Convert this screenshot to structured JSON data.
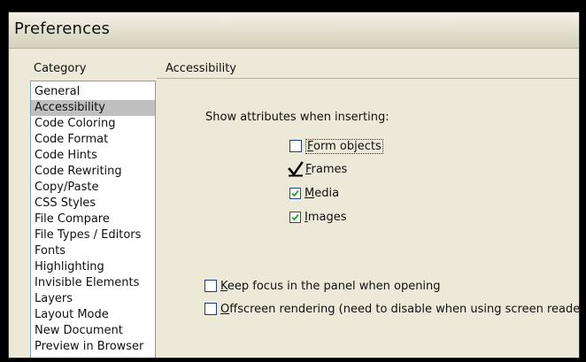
{
  "window": {
    "title": "Preferences"
  },
  "category": {
    "label": "Category",
    "items": [
      {
        "label": "General",
        "selected": false
      },
      {
        "label": "Accessibility",
        "selected": true
      },
      {
        "label": "Code Coloring",
        "selected": false
      },
      {
        "label": "Code Format",
        "selected": false
      },
      {
        "label": "Code Hints",
        "selected": false
      },
      {
        "label": "Code Rewriting",
        "selected": false
      },
      {
        "label": "Copy/Paste",
        "selected": false
      },
      {
        "label": "CSS Styles",
        "selected": false
      },
      {
        "label": "File Compare",
        "selected": false
      },
      {
        "label": "File Types / Editors",
        "selected": false
      },
      {
        "label": "Fonts",
        "selected": false
      },
      {
        "label": "Highlighting",
        "selected": false
      },
      {
        "label": "Invisible Elements",
        "selected": false
      },
      {
        "label": "Layers",
        "selected": false
      },
      {
        "label": "Layout Mode",
        "selected": false
      },
      {
        "label": "New Document",
        "selected": false
      },
      {
        "label": "Preview in Browser",
        "selected": false
      }
    ]
  },
  "panel": {
    "section_title": "Accessibility",
    "show_attributes_label": "Show attributes when inserting:",
    "form_objects": {
      "mnemonic": "F",
      "rest": "orm objects",
      "checked": false
    },
    "frames": {
      "mnemonic": "F",
      "rest": "rames",
      "checked": true
    },
    "media": {
      "mnemonic": "M",
      "rest": "edia",
      "checked": true
    },
    "images": {
      "mnemonic": "I",
      "rest": "mages",
      "checked": true
    },
    "keep_focus": {
      "mnemonic": "K",
      "rest": "eep focus in the panel when opening",
      "checked": false
    },
    "offscreen": {
      "mnemonic": "O",
      "rest": "ffscreen rendering (need to disable when using screen readers)",
      "checked": false
    }
  },
  "colors": {
    "dialog_bg": "#ece9d8",
    "selection": "#c0c0c0",
    "checkbox_border": "#1c5180",
    "checkmark": "#21a121"
  }
}
